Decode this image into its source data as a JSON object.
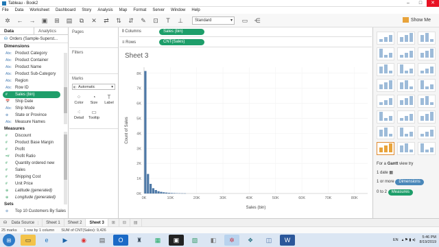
{
  "window": {
    "title": "Tableau - Book2"
  },
  "menu": [
    "File",
    "Data",
    "Worksheet",
    "Dashboard",
    "Story",
    "Analysis",
    "Map",
    "Format",
    "Server",
    "Window",
    "Help"
  ],
  "toolbar": {
    "fit": "Standard",
    "show_me": "Show Me"
  },
  "data_pane": {
    "tabs": [
      "Data",
      "Analytics"
    ],
    "datasource": "Orders (Sample-Superst...",
    "dimensions_header": "Dimensions",
    "dimensions": [
      {
        "type": "Abc",
        "name": "Product Category"
      },
      {
        "type": "Abc",
        "name": "Product Container"
      },
      {
        "type": "Abc",
        "name": "Product Name"
      },
      {
        "type": "Abc",
        "name": "Product Sub-Category"
      },
      {
        "type": "Abc",
        "name": "Region"
      },
      {
        "type": "Abc",
        "name": "Row ID"
      },
      {
        "type": "#",
        "name": "Sales (bin)"
      },
      {
        "type": "📅",
        "name": "Ship Date"
      },
      {
        "type": "Abc",
        "name": "Ship Mode"
      },
      {
        "type": "⊕",
        "name": "State or Province"
      },
      {
        "type": "Abc",
        "name": "Measure Names"
      }
    ],
    "measures_header": "Measures",
    "measures": [
      {
        "type": "#",
        "name": "Discount"
      },
      {
        "type": "#",
        "name": "Product Base Margin"
      },
      {
        "type": "#",
        "name": "Profit"
      },
      {
        "type": "=#",
        "name": "Profit Ratio"
      },
      {
        "type": "#",
        "name": "Quantity ordered new"
      },
      {
        "type": "#",
        "name": "Sales"
      },
      {
        "type": "#",
        "name": "Shipping Cost"
      },
      {
        "type": "#",
        "name": "Unit Price"
      },
      {
        "type": "⊕",
        "name": "Latitude (generated)"
      },
      {
        "type": "⊕",
        "name": "Longitude (generated)"
      }
    ],
    "sets_header": "Sets",
    "sets": [
      {
        "type": "⊚",
        "name": "Top 10 Customers By Sales"
      }
    ]
  },
  "cards": {
    "pages": "Pages",
    "filters": "Filters",
    "marks": "Marks",
    "marks_type": "Automatic",
    "mark_buttons": [
      "Color",
      "Size",
      "Label",
      "Detail",
      "Tooltip"
    ]
  },
  "shelves": {
    "columns_label": "Columns",
    "columns_pill": "Sales (bin)",
    "rows_label": "Rows",
    "rows_pill": "CNT(Sales)"
  },
  "sheet": {
    "title": "Sheet 3"
  },
  "chart_data": {
    "type": "bar",
    "xlabel": "Sales (bin)",
    "ylabel": "Count of Sales",
    "x_ticks": [
      "0K",
      "10K",
      "20K",
      "30K",
      "40K",
      "50K",
      "60K",
      "70K",
      "80K"
    ],
    "y_ticks": [
      "0K",
      "1K",
      "2K",
      "3K",
      "4K",
      "5K",
      "6K",
      "7K",
      "8K"
    ],
    "xlim": [
      0,
      85000
    ],
    "ylim": [
      0,
      8400
    ],
    "bin_width": 1000,
    "x": [
      0,
      1000,
      2000,
      3000,
      4000,
      5000,
      6000,
      7000,
      8000,
      9000,
      10000,
      11000,
      12000,
      13000,
      14000,
      15000
    ],
    "values": [
      8150,
      1300,
      640,
      350,
      230,
      150,
      110,
      80,
      60,
      45,
      35,
      28,
      20,
      15,
      12,
      10
    ],
    "color": "#4e79a7"
  },
  "show_me": {
    "for_a": "For a",
    "chart_name": "Gantt",
    "view_try": "view try",
    "req1": "1 date",
    "req2": "1 or more",
    "req2_chip": "Dimensions",
    "req3": "0 to 2",
    "req3_chip": "Measures"
  },
  "sheet_tabs": [
    "Data Source",
    "Sheet 1",
    "Sheet 2",
    "Sheet 3"
  ],
  "status": {
    "marks": "25 marks",
    "shape": "1 row by 1 column",
    "sum": "SUM of CNT(Sales): 9,426"
  },
  "tray": {
    "lang": "EN",
    "time": "5:46 PM",
    "date": "8/19/2019"
  }
}
